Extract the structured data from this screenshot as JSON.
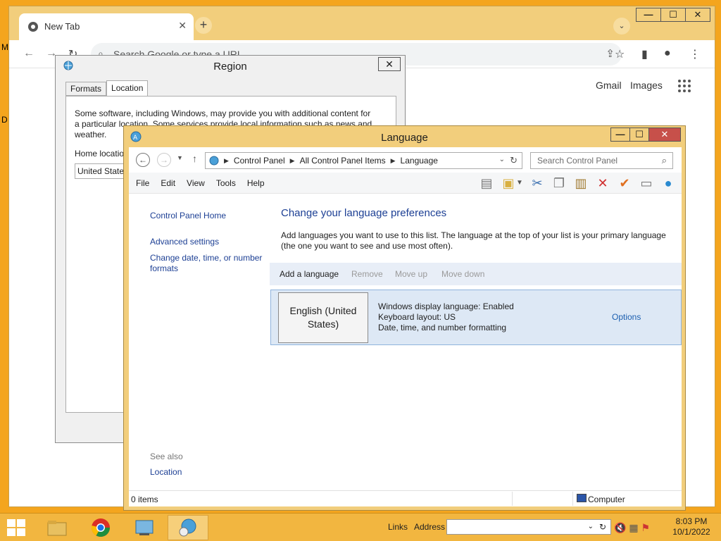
{
  "desktop": {
    "letters": [
      "M",
      "D"
    ]
  },
  "chrome": {
    "tab_title": "New Tab",
    "tab_close": "✕",
    "new_tab": "+",
    "tab_search": "⌄",
    "win_minimize": "—",
    "win_maximize": "☐",
    "win_close": "✕",
    "omnibox_placeholder": "Search Google or type a URL",
    "links": {
      "gmail": "Gmail",
      "images": "Images"
    }
  },
  "region": {
    "title": "Region",
    "close": "✕",
    "tabs": [
      "Formats",
      "Location"
    ],
    "active_tab": "Location",
    "description": "Some software, including Windows, may provide you with additional content for a particular location. Some services provide local information such as news and weather.",
    "home_location_label": "Home location:",
    "home_location_value": "United States"
  },
  "language": {
    "title": "Language",
    "win_minimize": "—",
    "win_maximize": "☐",
    "win_close": "✕",
    "breadcrumbs": [
      "Control Panel",
      "All Control Panel Items",
      "Language"
    ],
    "search_placeholder": "Search Control Panel",
    "menu": [
      "File",
      "Edit",
      "View",
      "Tools",
      "Help"
    ],
    "left_links": [
      "Control Panel Home",
      "Advanced settings",
      "Change date, time, or number formats"
    ],
    "see_also": "See also",
    "see_also_location": "Location",
    "heading": "Change your language preferences",
    "intro": "Add languages you want to use to this list. The language at the top of your list is your primary language (the one you want to see and use most often).",
    "commands": {
      "add": "Add a language",
      "remove": "Remove",
      "up": "Move up",
      "down": "Move down"
    },
    "language_entry": {
      "name": "English (United States)",
      "display": "Windows display language: Enabled",
      "keyboard": "Keyboard layout: US",
      "formatting": "Date, time, and number formatting",
      "options": "Options"
    },
    "status_items": "0 items",
    "status_computer": "Computer"
  },
  "taskbar": {
    "links": "Links",
    "address": "Address",
    "time": "8:03 PM",
    "date": "10/1/2022"
  },
  "colors": {
    "desktop": "#f4a51e",
    "window_frame": "#f2ce7c",
    "link": "#1c3f94",
    "close_red": "#c7504a"
  }
}
